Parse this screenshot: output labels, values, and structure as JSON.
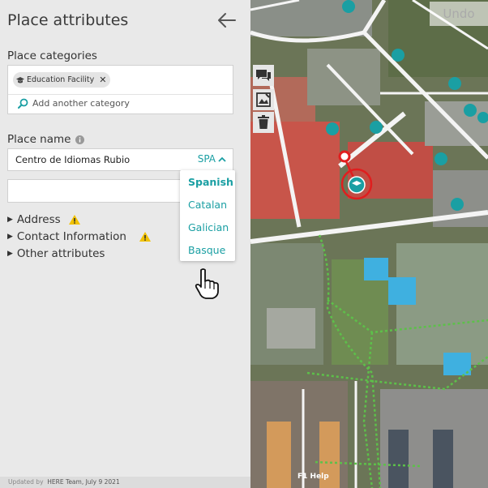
{
  "panel": {
    "title": "Place attributes",
    "categories_label": "Place categories",
    "category_chip": "Education Facility",
    "add_category_placeholder": "Add another category",
    "place_name_label": "Place name",
    "place_name_value": "Centro de Idiomas Rubio",
    "language_code": "SPA",
    "languages": [
      "Spanish",
      "Catalan",
      "Galician",
      "Basque"
    ],
    "selected_language": "Spanish",
    "address_label": "Address",
    "contact_label": "Contact Information",
    "other_label": "Other attributes",
    "footer_prefix": "Updated by",
    "footer_author": "HERE Team, July 9 2021"
  },
  "map": {
    "undo_label": "Undo",
    "help_label": "F1 Help"
  },
  "colors": {
    "accent": "#1a9fa3",
    "warning": "#f2c200",
    "selection": "#e01e1e",
    "path": "#5dc04a"
  }
}
